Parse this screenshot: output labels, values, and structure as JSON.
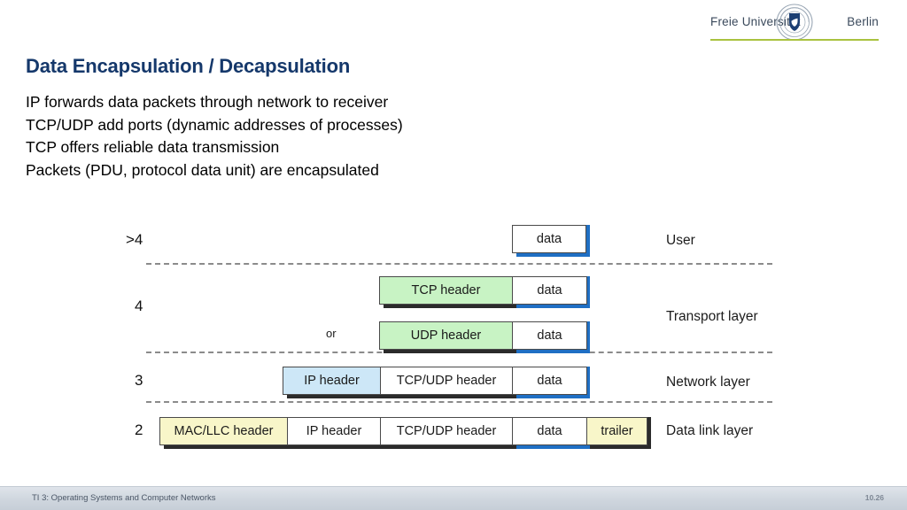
{
  "logo": {
    "left_text": "Freie Universität",
    "right_text": "Berlin",
    "seal_name": "university-seal",
    "rule_color": "#a9c23f",
    "text_color": "#3b4a5c"
  },
  "slide": {
    "title": "Data Encapsulation / Decapsulation",
    "title_color": "#15386b",
    "bullets": [
      "IP forwards data packets through network to receiver",
      "TCP/UDP add ports (dynamic addresses of processes)",
      "TCP offers reliable data transmission",
      "Packets (PDU, protocol data unit) are encapsulated"
    ]
  },
  "diagram": {
    "or_label": "or",
    "colors": {
      "transport_header": "#c8f3c4",
      "network_header": "#cde7f7",
      "datalink_header": "#f8f6c9",
      "payload": "#ffffff",
      "payload_shadow": "#1f6fc4",
      "header_shadow": "#2b2b2b",
      "separator": "#8b8b8b"
    },
    "layer_numbers": [
      ">4",
      "4",
      "3",
      "2"
    ],
    "layer_names": [
      "User",
      "Transport layer",
      "Network layer",
      "Data link layer"
    ],
    "rows": [
      {
        "layer_number": ">4",
        "layer_name": "User",
        "segments": [
          {
            "label": "data",
            "fill": "payload"
          }
        ]
      },
      {
        "layer_number": "4",
        "layer_name": "Transport layer",
        "segments": [
          {
            "label": "TCP header",
            "fill": "transport_header"
          },
          {
            "label": "data",
            "fill": "payload"
          }
        ]
      },
      {
        "layer_number": "4",
        "layer_name": "Transport layer",
        "segments": [
          {
            "label": "UDP header",
            "fill": "transport_header"
          },
          {
            "label": "data",
            "fill": "payload"
          }
        ]
      },
      {
        "layer_number": "3",
        "layer_name": "Network layer",
        "segments": [
          {
            "label": "IP header",
            "fill": "network_header"
          },
          {
            "label": "TCP/UDP header",
            "fill": "payload"
          },
          {
            "label": "data",
            "fill": "payload"
          }
        ]
      },
      {
        "layer_number": "2",
        "layer_name": "Data link layer",
        "segments": [
          {
            "label": "MAC/LLC header",
            "fill": "datalink_header"
          },
          {
            "label": "IP header",
            "fill": "payload"
          },
          {
            "label": "TCP/UDP header",
            "fill": "payload"
          },
          {
            "label": "data",
            "fill": "payload"
          },
          {
            "label": "trailer",
            "fill": "datalink_header"
          }
        ]
      }
    ]
  },
  "footer": {
    "course": "TI 3: Operating Systems and Computer Networks",
    "page": "10.26"
  }
}
